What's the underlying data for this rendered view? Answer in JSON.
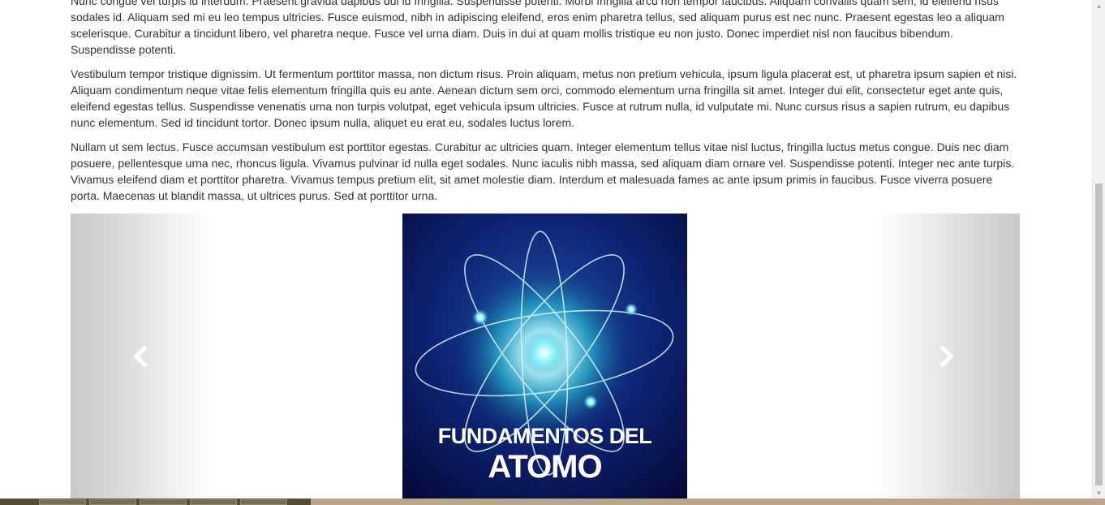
{
  "paragraphs": [
    "Nunc congue vel turpis id interdum. Praesent gravida dapibus dui id fringilla. Suspendisse potenti. Morbi fringilla arcu non tempor faucibus. Aliquam convallis quam sem, id eleifend risus sodales id. Aliquam sed mi eu leo tempus ultricies. Fusce euismod, nibh in adipiscing eleifend, eros enim pharetra tellus, sed aliquam purus est nec nunc. Praesent egestas leo a aliquam scelerisque. Curabitur a tincidunt libero, vel pharetra neque. Fusce vel urna diam. Duis in dui at quam mollis tristique eu non justo. Donec imperdiet nisl non faucibus bibendum. Suspendisse potenti.",
    "Vestibulum tempor tristique dignissim. Ut fermentum porttitor massa, non dictum risus. Proin aliquam, metus non pretium vehicula, ipsum ligula placerat est, ut pharetra ipsum sapien et nisi. Aliquam condimentum neque vitae felis elementum fringilla quis eu ante. Aenean dictum sem orci, commodo elementum urna fringilla sit amet. Integer dui elit, consectetur eget ante quis, eleifend egestas tellus. Suspendisse venenatis urna non turpis volutpat, eget vehicula ipsum ultricies. Fusce at rutrum nulla, id vulputate mi. Nunc cursus risus a sapien rutrum, eu dapibus nunc elementum. Sed id tincidunt tortor. Donec ipsum nulla, aliquet eu erat eu, sodales luctus lorem.",
    "Nullam ut sem lectus. Fusce accumsan vestibulum est porttitor egestas. Curabitur ac ultricies quam. Integer elementum tellus vitae nisl luctus, fringilla luctus metus congue. Duis nec diam posuere, pellentesque urna nec, rhoncus ligula. Vivamus pulvinar id nulla eget sodales. Nunc iaculis nibh massa, sed aliquam diam ornare vel. Suspendisse potenti. Integer nec ante turpis. Vivamus eleifend diam et porttitor pharetra. Vivamus tempus pretium elit, sit amet molestie diam. Interdum et malesuada fames ac ante ipsum primis in faucibus. Fusce viverra posuere porta. Maecenas ut blandit massa, ut ultrices purus. Sed at porttitor urna."
  ],
  "carousel": {
    "slide_title_line1": "FUNDAMENTOS DEL",
    "slide_title_line2": "ATOMO",
    "prev_icon": "chevron-left-icon",
    "next_icon": "chevron-right-icon"
  },
  "colors": {
    "slide_bg_dark": "#0a1c5c",
    "slide_glow": "#7ff0ff"
  }
}
